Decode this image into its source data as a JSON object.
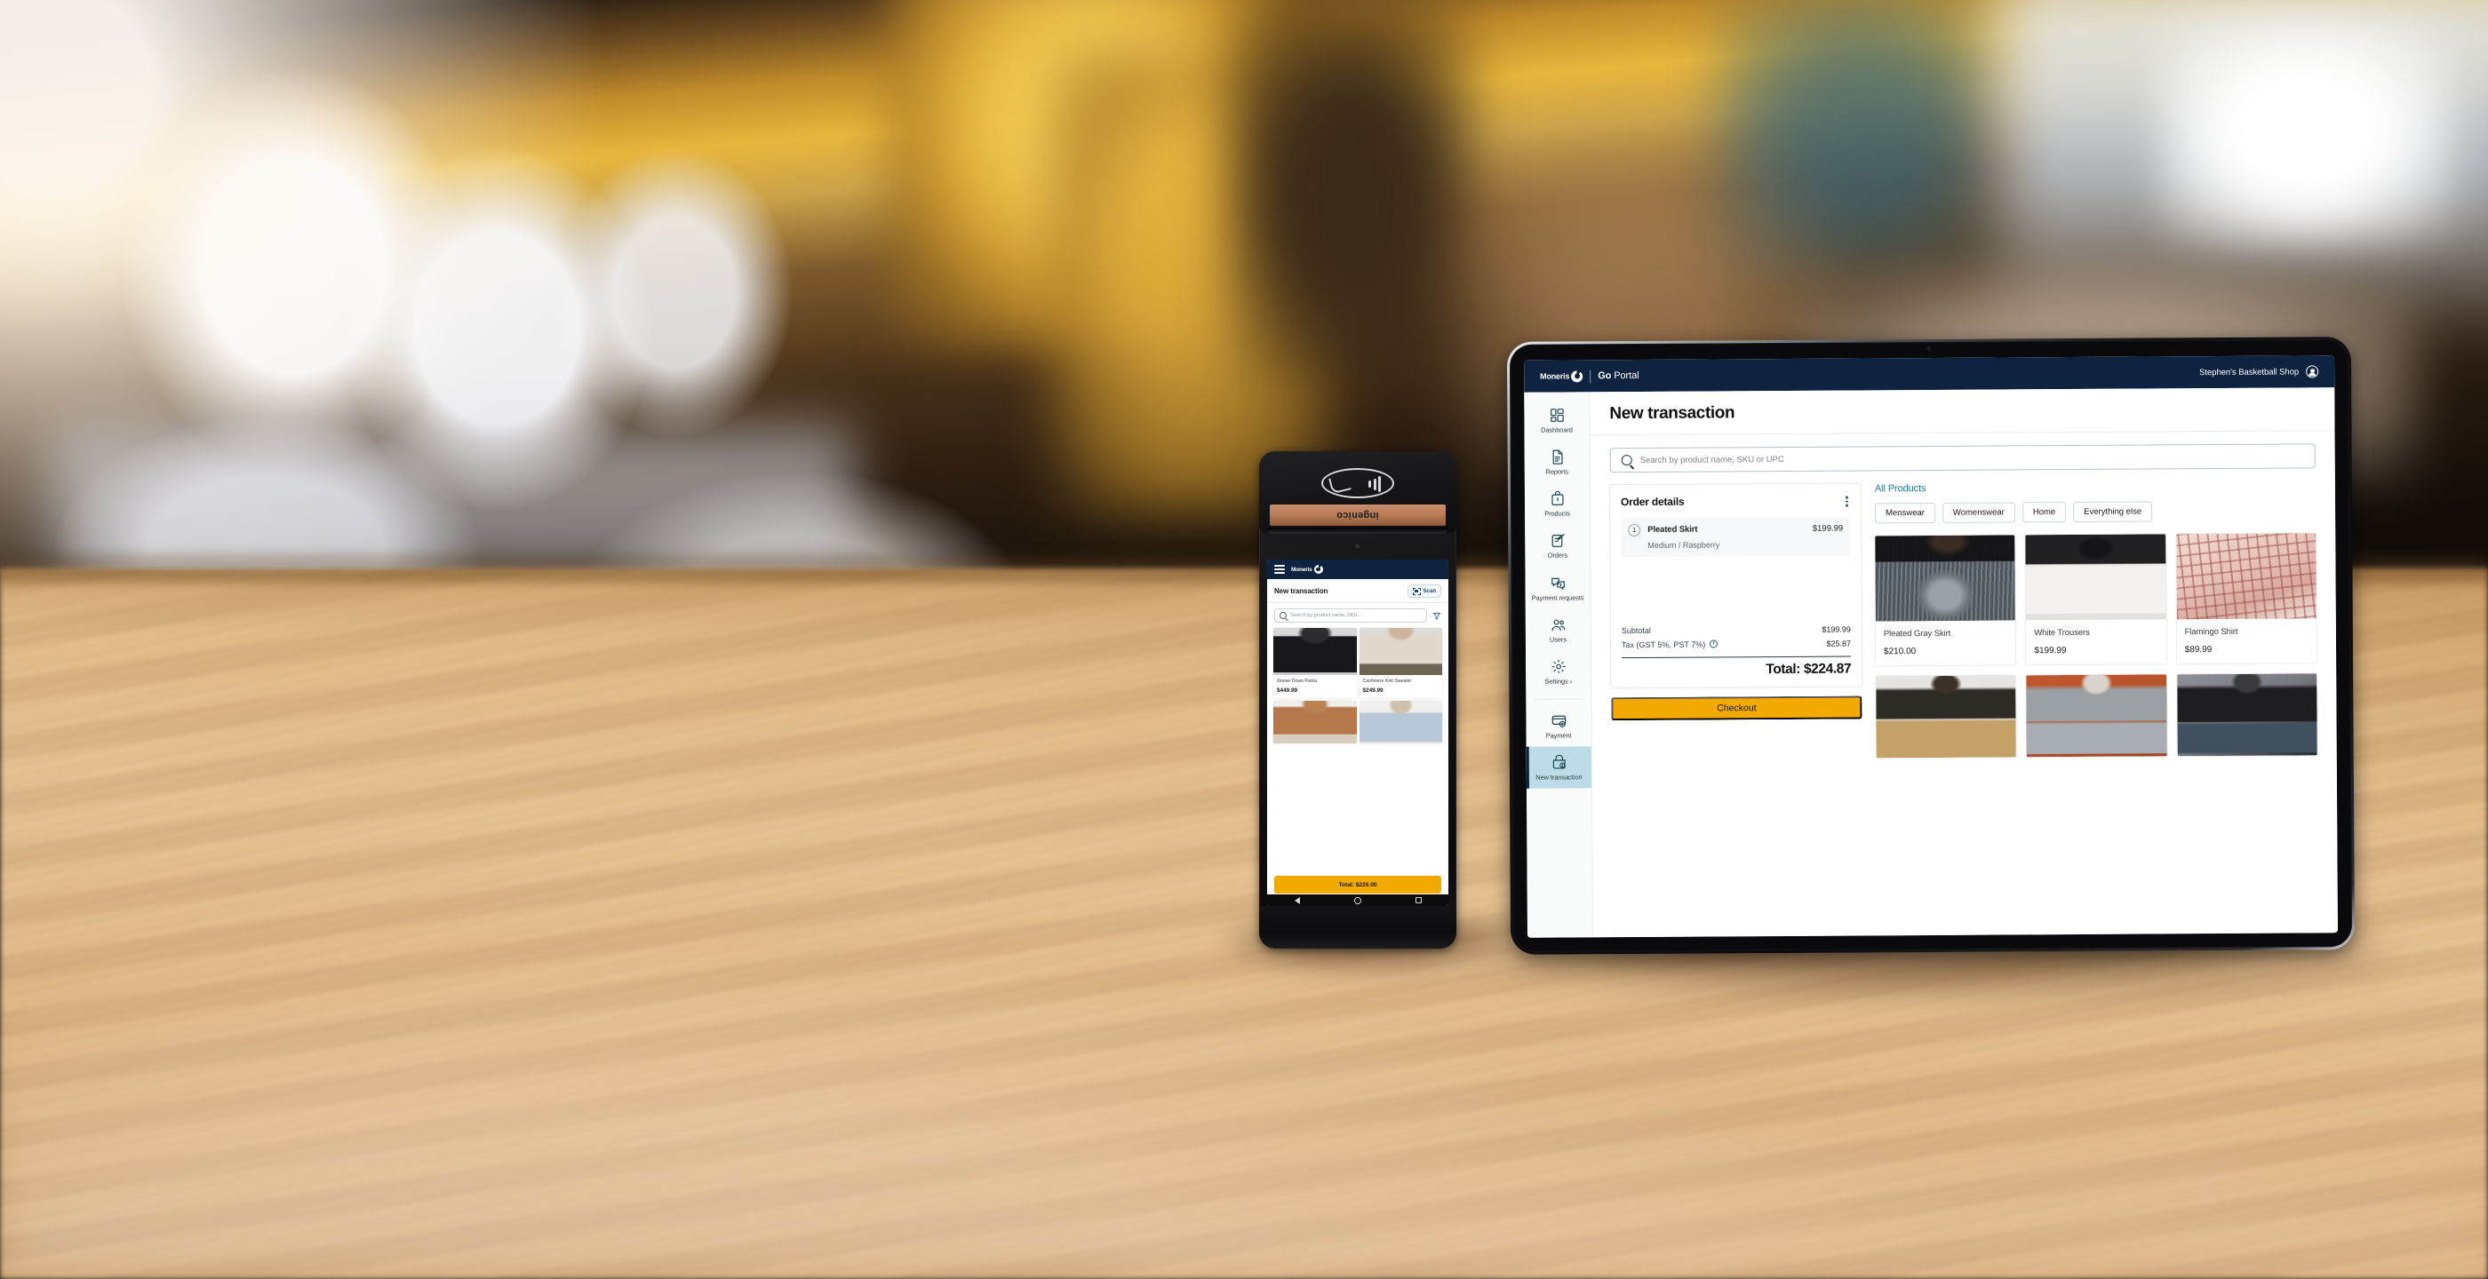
{
  "scene": {
    "description": "Moneris Go Portal on tablet beside an Ingenico payment terminal on a wooden retail counter"
  },
  "terminal": {
    "brand": "ingenico",
    "contactless_icon": "contactless-payment-icon",
    "screen": {
      "header": {
        "menu_icon": "hamburger-menu-icon",
        "logo_text": "Moneris"
      },
      "title": "New transaction",
      "scan_button": {
        "label": "Scan",
        "icon": "barcode-scan-icon"
      },
      "search": {
        "placeholder": "Search by product name, SKU...",
        "icon": "search-icon"
      },
      "filter_icon": "filter-funnel-icon",
      "products": [
        {
          "name": "Goose Down Parka",
          "price": "$449.99",
          "image": "im-parka"
        },
        {
          "name": "Cashmere Knit Sweater",
          "price": "$249.99",
          "image": "im-sweater"
        },
        {
          "name": "",
          "price": "",
          "image": "im-camel"
        },
        {
          "name": "",
          "price": "",
          "image": "im-jeans"
        }
      ],
      "total_button": "Total: $226.00",
      "navbar": {
        "back": "back-icon",
        "home": "home-icon",
        "recents": "recents-icon"
      }
    }
  },
  "tablet": {
    "header": {
      "brand_name": "Moneris",
      "product_bold": "Go",
      "product_rest": " Portal",
      "merchant": "Stephen's Basketball Shop",
      "avatar_icon": "user-avatar-icon"
    },
    "sidebar": {
      "items": [
        {
          "label": "Dashboard",
          "icon": "dashboard-icon",
          "active": false
        },
        {
          "label": "Reports",
          "icon": "report-document-icon",
          "active": false
        },
        {
          "label": "Products",
          "icon": "product-box-icon",
          "active": false
        },
        {
          "label": "Orders",
          "icon": "orders-clipboard-icon",
          "active": false
        },
        {
          "label": "Payment requests",
          "icon": "payment-request-icon",
          "active": false
        },
        {
          "label": "Users",
          "icon": "users-icon",
          "active": false
        },
        {
          "label": "Settings",
          "icon": "gear-icon",
          "active": false,
          "chevron": "›"
        },
        {
          "label": "Payment",
          "icon": "payment-card-icon",
          "active": false
        },
        {
          "label": "New transaction",
          "icon": "new-transaction-icon",
          "active": true
        }
      ]
    },
    "main": {
      "page_title": "New transaction",
      "search": {
        "placeholder": "Search by product name, SKU or UPC",
        "icon": "search-icon"
      },
      "order": {
        "title": "Order details",
        "kebab_icon": "more-options-icon",
        "line_items": [
          {
            "qty": "1",
            "name": "Pleated Skirt",
            "price": "$199.99",
            "variant": "Medium / Raspberry"
          }
        ],
        "subtotal_label": "Subtotal",
        "subtotal_value": "$199.99",
        "tax_label": "Tax (GST 5%, PST 7%)",
        "tax_info_icon": "info-icon",
        "tax_value": "$25.87",
        "total_text": "Total: $224.87",
        "checkout_label": "Checkout"
      },
      "catalog": {
        "heading": "All Products",
        "categories": [
          "Menswear",
          "Womenswear",
          "Home",
          "Everything else"
        ],
        "products": [
          {
            "name": "Pleated Gray Skirt",
            "price": "$210.00",
            "image": "im-skirt"
          },
          {
            "name": "White Trousers",
            "price": "$199.99",
            "image": "im-trousers"
          },
          {
            "name": "Flamingo Shirt",
            "price": "$89.99",
            "image": "im-flamingo"
          },
          {
            "name": "",
            "price": "",
            "image": "im-tan"
          },
          {
            "name": "",
            "price": "",
            "image": "im-rust"
          },
          {
            "name": "",
            "price": "",
            "image": "im-navy"
          }
        ]
      }
    }
  },
  "colors": {
    "brand_navy": "#0D2340",
    "accent_amber": "#F2A900",
    "active_sidebar": "#BCDDE8",
    "link_teal": "#2b7a93"
  }
}
